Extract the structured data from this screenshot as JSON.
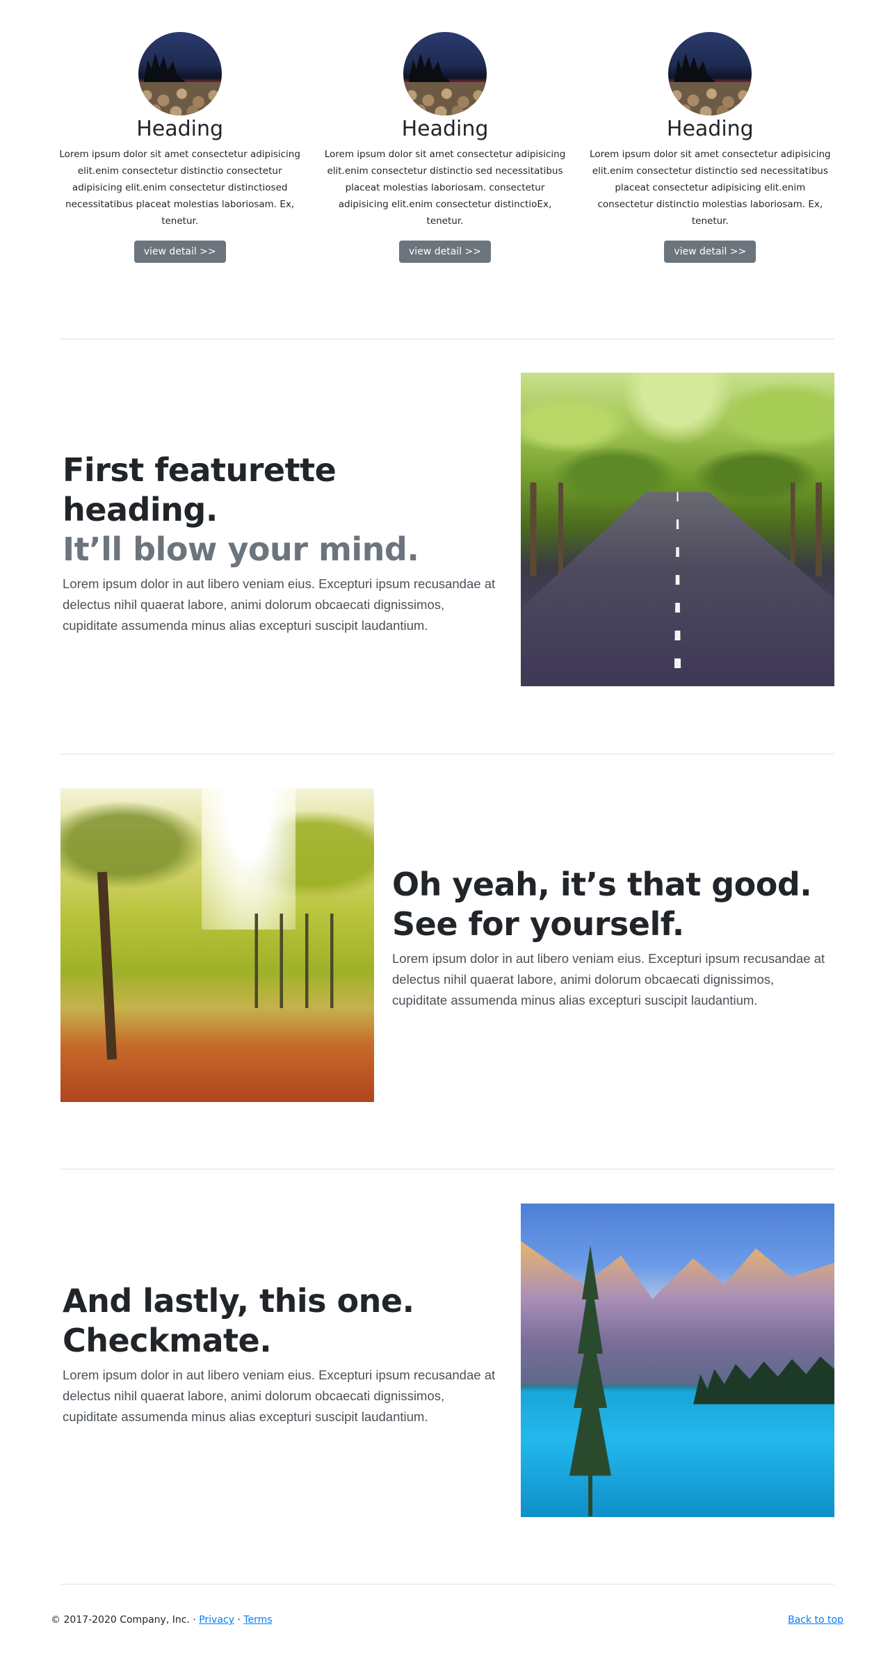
{
  "marketing": {
    "columns": [
      {
        "heading": "Heading",
        "text": "Lorem ipsum dolor sit amet consectetur adipisicing elit.enim consectetur distinctio consectetur adipisicing elit.enim consectetur distinctiosed necessitatibus placeat molestias laboriosam. Ex, tenetur.",
        "button": "view detail >>"
      },
      {
        "heading": "Heading",
        "text": "Lorem ipsum dolor sit amet consectetur adipisicing elit.enim consectetur distinctio sed necessitatibus placeat molestias laboriosam. consectetur adipisicing elit.enim consectetur distinctioEx, tenetur.",
        "button": "view detail >>"
      },
      {
        "heading": "Heading",
        "text": "Lorem ipsum dolor sit amet consectetur adipisicing elit.enim consectetur distinctio sed necessitatibus placeat consectetur adipisicing elit.enim consectetur distinctio molestias laboriosam. Ex, tenetur.",
        "button": "view detail >>"
      }
    ]
  },
  "featurettes": [
    {
      "heading": "First featurette heading.",
      "muted": "It’ll blow your mind.",
      "body": "Lorem ipsum dolor in aut libero veniam eius. Excepturi ipsum recusandae at delectus nihil quaerat labore, animi dolorum obcaecati dignissimos, cupiditate assumenda minus alias excepturi suscipit laudantium."
    },
    {
      "heading": "Oh yeah, it’s that good. See for yourself.",
      "muted": "",
      "body": "Lorem ipsum dolor in aut libero veniam eius. Excepturi ipsum recusandae at delectus nihil quaerat labore, animi dolorum obcaecati dignissimos, cupiditate assumenda minus alias excepturi suscipit laudantium."
    },
    {
      "heading": "And lastly, this one. Checkmate.",
      "muted": "",
      "body": "Lorem ipsum dolor in aut libero veniam eius. Excepturi ipsum recusandae at delectus nihil quaerat labore, animi dolorum obcaecati dignissimos, cupiditate assumenda minus alias excepturi suscipit laudantium."
    }
  ],
  "footer": {
    "copyright": "© 2017-2020 Company, Inc. · ",
    "privacy": "Privacy",
    "separator": " · ",
    "terms": "Terms",
    "back_to_top": "Back to top"
  },
  "colors": {
    "button_bg": "#6c757d",
    "link": "#007bff",
    "muted_heading": "#6c757d"
  }
}
